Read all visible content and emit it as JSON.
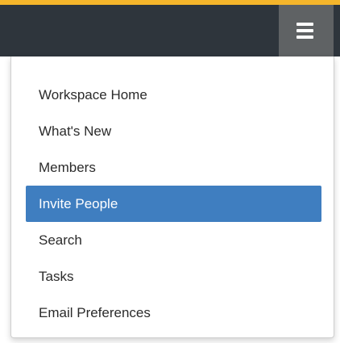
{
  "theme": {
    "accent": "#f5b52b",
    "navbar_bg": "#2e353c",
    "toggle_bg": "#5f6264",
    "active_bg": "#3f7ec0"
  },
  "navbar": {
    "toggle_icon": "hamburger-menu-icon"
  },
  "menu": {
    "items": [
      {
        "label": "Workspace Home"
      },
      {
        "label": "What's New"
      },
      {
        "label": "Members"
      },
      {
        "label": "Invite People",
        "active": true
      },
      {
        "label": "Search"
      },
      {
        "label": "Tasks"
      },
      {
        "label": "Email Preferences"
      }
    ]
  }
}
